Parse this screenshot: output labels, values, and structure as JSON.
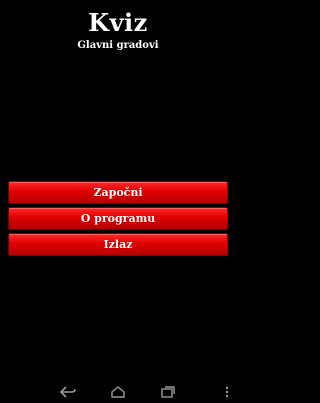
{
  "header": {
    "title": "Kviz",
    "subtitle": "Glavni gradovi"
  },
  "menu": {
    "buttons": [
      {
        "label": "Započni"
      },
      {
        "label": "O programu"
      },
      {
        "label": "Izlaz"
      }
    ]
  },
  "navbar": {
    "icons": [
      "back-icon",
      "home-icon",
      "recent-apps-icon",
      "more-icon"
    ]
  },
  "colors": {
    "background": "#000000",
    "button_top": "#ff2a2a",
    "button_bottom": "#b30000",
    "text": "#ffffff",
    "nav_icon": "#9a9a9a"
  }
}
